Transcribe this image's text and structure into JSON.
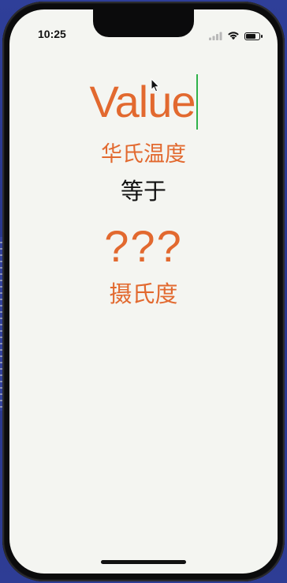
{
  "status_bar": {
    "time": "10:25",
    "battery_level": 0.85
  },
  "converter": {
    "input_placeholder": "Value",
    "input_value": "",
    "from_unit": "华氏温度",
    "equals_text": "等于",
    "result": "???",
    "to_unit": "摄氏度"
  },
  "colors": {
    "accent": "#e2692f",
    "caret": "#2fb24a",
    "background": "#f4f5f1",
    "text": "#111111"
  },
  "icons": {
    "signal": "cellular-signal-icon",
    "wifi": "wifi-icon",
    "battery": "battery-icon",
    "cursor": "mouse-pointer-icon"
  }
}
